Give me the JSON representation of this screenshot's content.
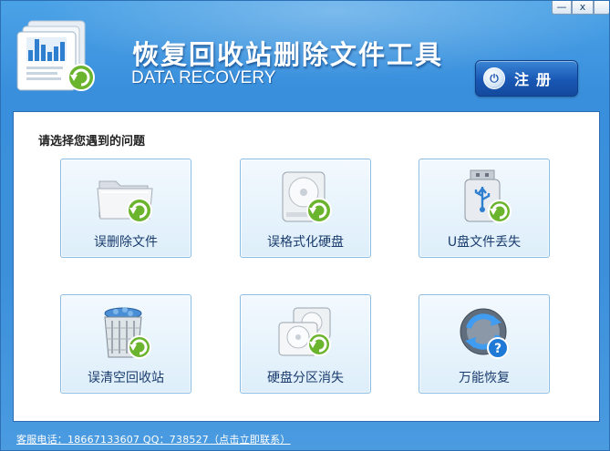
{
  "window": {
    "title": "恢复回收站删除文件工具",
    "subtitle": "DATA RECOVERY",
    "minimize_symbol": "—",
    "close_symbol": "x"
  },
  "header": {
    "register_label": "注册",
    "register_icon": "power-icon"
  },
  "panel": {
    "heading": "请选择您遇到的问题",
    "options": [
      {
        "label": "误删除文件",
        "icon": "folder-recover-icon"
      },
      {
        "label": "误格式化硬盘",
        "icon": "harddisk-recover-icon"
      },
      {
        "label": "U盘文件丢失",
        "icon": "usb-drive-recover-icon"
      },
      {
        "label": "误清空回收站",
        "icon": "recycle-bin-recover-icon"
      },
      {
        "label": "硬盘分区消失",
        "icon": "partition-recover-icon"
      },
      {
        "label": "万能恢复",
        "icon": "universal-recover-icon"
      }
    ]
  },
  "footer": {
    "contact_text": "客服电话：18667133607 QQ：738527（点击立即联系）"
  },
  "colors": {
    "frame_blue": "#3c90da",
    "register_blue": "#1957b4",
    "card_border": "#8bbde4",
    "recover_green": "#6bb42e"
  }
}
